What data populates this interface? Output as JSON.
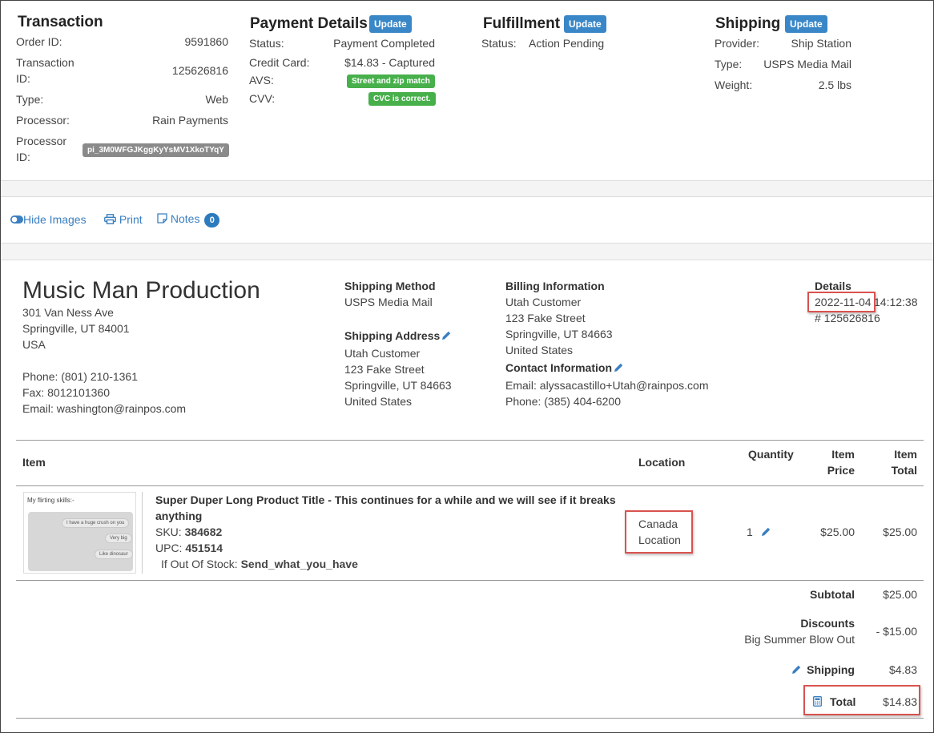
{
  "transaction": {
    "title": "Transaction",
    "order_id_label": "Order ID:",
    "order_id": "9591860",
    "transaction_id_label_1": "Transaction",
    "transaction_id_label_2": "ID:",
    "transaction_id": "125626816",
    "type_label": "Type:",
    "type": "Web",
    "processor_label": "Processor:",
    "processor": "Rain Payments",
    "processor_id_label_1": "Processor",
    "processor_id_label_2": "ID:",
    "processor_id": "pi_3M0WFGJKggKyYsMV1XkoTYqY"
  },
  "payment": {
    "title": "Payment Details",
    "update_label": "Update",
    "status_label": "Status:",
    "status": "Payment Completed",
    "card_label": "Credit Card:",
    "card": "$14.83 - Captured",
    "avs_label": "AVS:",
    "avs": "Street and zip match",
    "cvv_label": "CVV:",
    "cvv": "CVC is correct."
  },
  "fulfillment": {
    "title": "Fulfillment",
    "update_label": "Update",
    "status_label": "Status:",
    "status": "Action Pending"
  },
  "shipping": {
    "title": "Shipping",
    "update_label": "Update",
    "provider_label": "Provider:",
    "provider": "Ship Station",
    "type_label": "Type:",
    "type": "USPS Media Mail",
    "weight_label": "Weight:",
    "weight": "2.5 lbs"
  },
  "toolbar": {
    "hide_images": "Hide Images",
    "print": "Print",
    "notes": "Notes",
    "notes_count": "0"
  },
  "store": {
    "name": "Music Man Production",
    "address1": "301 Van Ness Ave",
    "address2": "Springville, UT 84001",
    "country": "USA",
    "phone": "Phone: (801) 210-1361",
    "fax": "Fax: 8012101360",
    "email": "Email: washington@rainpos.com"
  },
  "shipping_method": {
    "title": "Shipping Method",
    "value": "USPS Media Mail"
  },
  "shipping_address": {
    "title": "Shipping Address",
    "name": "Utah Customer",
    "street": "123 Fake Street",
    "city": "Springville, UT 84663",
    "country": "United States"
  },
  "billing": {
    "title": "Billing Information",
    "name": "Utah Customer",
    "street": "123 Fake Street",
    "city": "Springville, UT 84663",
    "country": "United States"
  },
  "contact": {
    "title": "Contact Information",
    "email": "Email: alyssacastillo+Utah@rainpos.com",
    "phone": "Phone: (385) 404-6200"
  },
  "details": {
    "title": "Details",
    "date": "2022-11-04",
    "time": "14:12:38",
    "number": "# 125626816"
  },
  "table": {
    "col_item": "Item",
    "col_location": "Location",
    "col_quantity": "Quantity",
    "col_price_1": "Item",
    "col_price_2": "Price",
    "col_total_1": "Item",
    "col_total_2": "Total"
  },
  "item": {
    "thumb_caption": "My flirting skills:-",
    "bubble1": "I have a huge crush on you",
    "bubble2": "Very big",
    "bubble3": "Like dinosaur",
    "title_line1": "Super Duper Long Product Title - This continues for a while and we will see if it breaks",
    "title_line2": "anything",
    "sku_label": "SKU:",
    "sku": "384682",
    "upc_label": "UPC:",
    "upc": "451514",
    "oos_label": "If Out Of Stock:",
    "oos": "Send_what_you_have",
    "location_1": "Canada",
    "location_2": "Location",
    "quantity": "1",
    "price": "$25.00",
    "total": "$25.00"
  },
  "totals": {
    "subtotal_label": "Subtotal",
    "subtotal": "$25.00",
    "discounts_label": "Discounts",
    "discount_name": "Big Summer Blow Out",
    "discount": "- $15.00",
    "shipping_label": "Shipping",
    "shipping": "$4.83",
    "total_label": "Total",
    "total": "$14.83"
  },
  "colors": {
    "accent": "#3a87c7",
    "success": "#47b04b",
    "highlight": "#d9534f"
  }
}
